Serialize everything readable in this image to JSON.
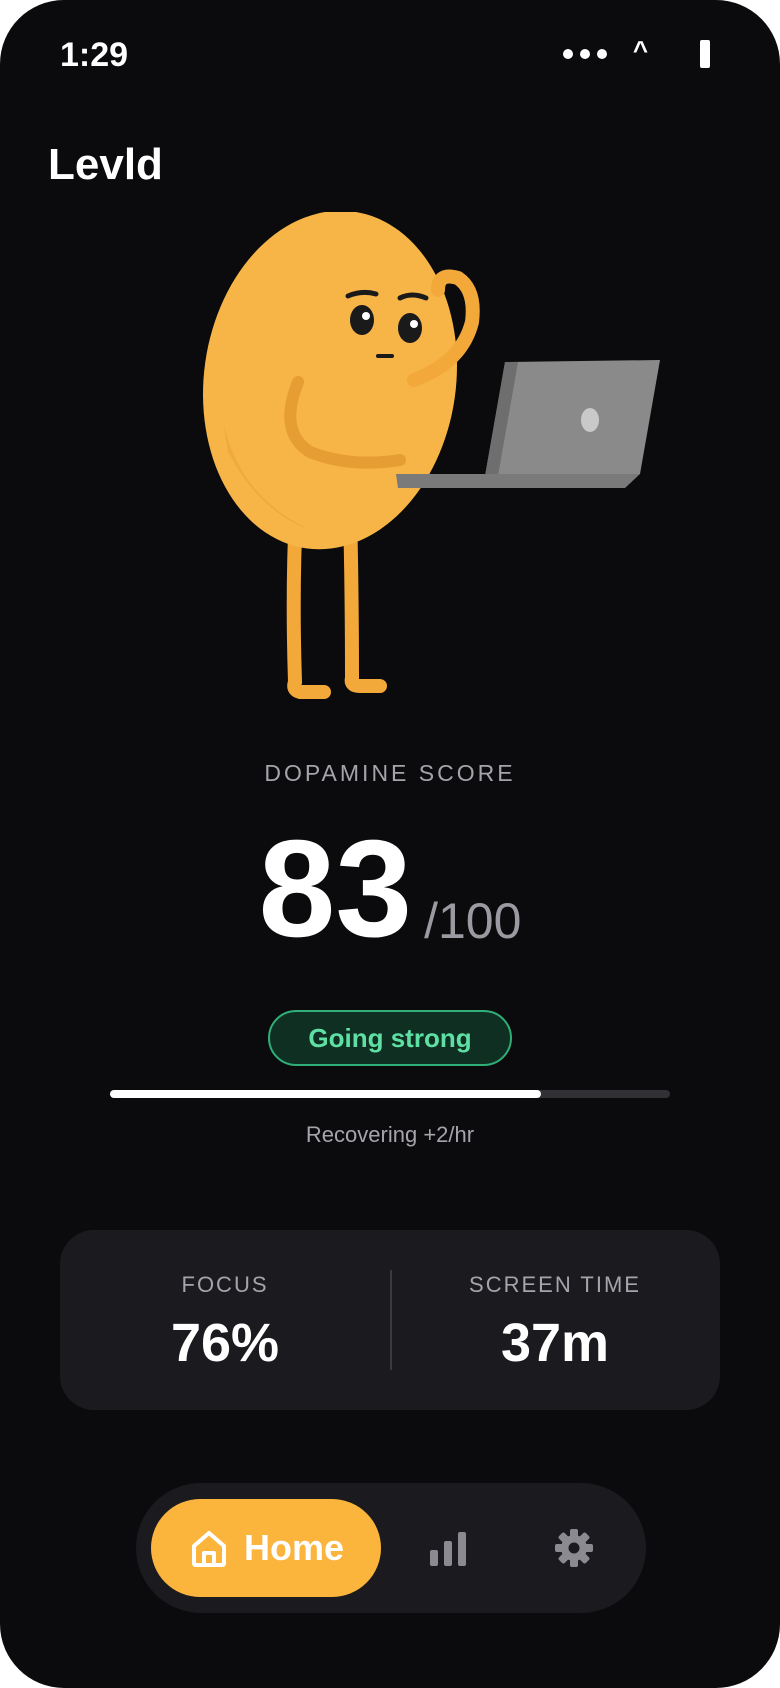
{
  "status_bar": {
    "time": "1:29"
  },
  "app": {
    "title": "Levld"
  },
  "score": {
    "label": "DOPAMINE SCORE",
    "value": "83",
    "max": "/100",
    "status_badge": "Going strong",
    "progress": 0.77,
    "recovery_text": "Recovering +2/hr"
  },
  "stats": {
    "focus": {
      "label": "FOCUS",
      "value": "76%"
    },
    "screen_time": {
      "label": "SCREEN TIME",
      "value": "37m"
    }
  },
  "nav": {
    "items": [
      {
        "label": "Home",
        "icon": "home-icon",
        "active": true
      },
      {
        "label": "",
        "icon": "bar-chart-icon",
        "active": false
      },
      {
        "label": "",
        "icon": "gear-icon",
        "active": false
      }
    ]
  },
  "colors": {
    "background": "#0b0b0d",
    "accent": "#fbb53c",
    "badge_green": "#5ee0a4",
    "card": "#1b1b1f"
  }
}
